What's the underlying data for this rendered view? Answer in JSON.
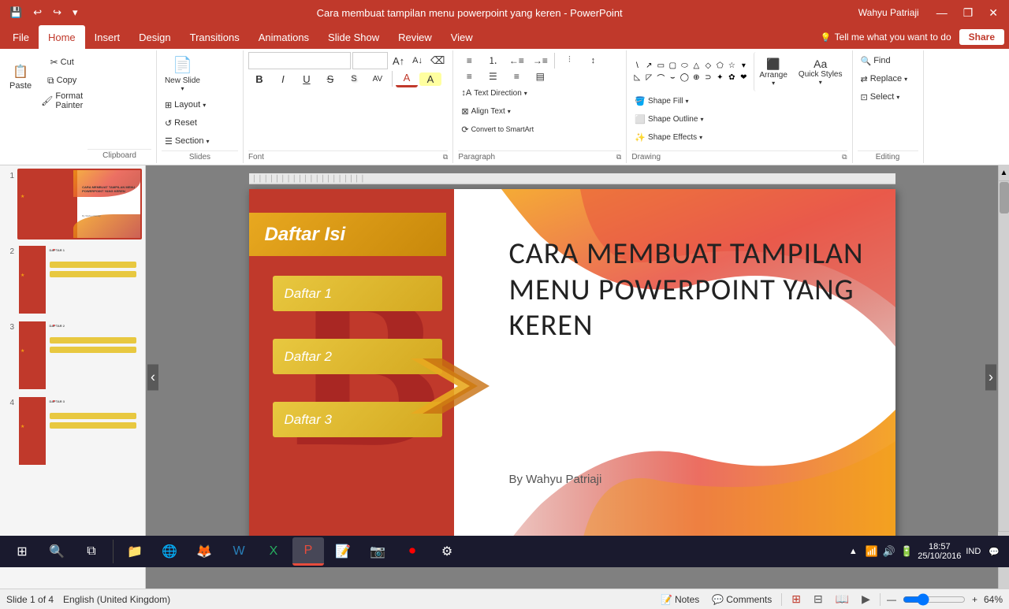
{
  "app": {
    "title": "Cara membuat tampilan menu powerpoint yang keren - PowerPoint",
    "user": "Wahyu Patriaji",
    "window_controls": [
      "minimize",
      "restore",
      "close"
    ]
  },
  "quick_access": {
    "buttons": [
      "save",
      "undo",
      "redo",
      "customize"
    ]
  },
  "tabs": [
    {
      "id": "file",
      "label": "File"
    },
    {
      "id": "home",
      "label": "Home",
      "active": true
    },
    {
      "id": "insert",
      "label": "Insert"
    },
    {
      "id": "design",
      "label": "Design"
    },
    {
      "id": "transitions",
      "label": "Transitions"
    },
    {
      "id": "animations",
      "label": "Animations"
    },
    {
      "id": "slideshow",
      "label": "Slide Show"
    },
    {
      "id": "review",
      "label": "Review"
    },
    {
      "id": "view",
      "label": "View"
    },
    {
      "id": "tellme",
      "label": "Tell me what you want to do"
    }
  ],
  "share_button": "Share",
  "ribbon": {
    "groups": {
      "clipboard": {
        "label": "Clipboard",
        "paste": "Paste",
        "cut": "Cut",
        "copy": "Copy",
        "format_painter": "Format Painter"
      },
      "slides": {
        "label": "Slides",
        "new_slide": "New Slide",
        "layout": "Layout",
        "reset": "Reset",
        "section": "Section"
      },
      "font": {
        "label": "Font",
        "font_name": "",
        "font_size": "",
        "grow": "A",
        "shrink": "A",
        "clear": "Clear All Formatting",
        "bold": "B",
        "italic": "I",
        "underline": "U",
        "strikethrough": "S",
        "shadow": "S",
        "char_spacing": "AV",
        "color": "A",
        "highlight": "A"
      },
      "paragraph": {
        "label": "Paragraph",
        "bullets": "Bullets",
        "numbering": "Numbering",
        "decrease_indent": "Decrease",
        "increase_indent": "Increase",
        "columns": "Columns",
        "line_spacing": "Line Spacing",
        "align_left": "Align Left",
        "align_center": "Center",
        "align_right": "Align Right",
        "justify": "Justify",
        "text_direction": "Text Direction",
        "align_text": "Align Text",
        "convert_smartart": "Convert to SmartArt"
      },
      "drawing": {
        "label": "Drawing",
        "arrange": "Arrange",
        "quick_styles": "Quick Styles",
        "shape_fill": "Shape Fill",
        "shape_outline": "Shape Outline",
        "shape_effects": "Shape Effects"
      },
      "editing": {
        "label": "Editing",
        "find": "Find",
        "replace": "Replace",
        "select": "Select"
      }
    }
  },
  "slide_panel": {
    "slides": [
      {
        "num": 1,
        "active": true,
        "type": "title"
      },
      {
        "num": 2,
        "active": false,
        "type": "content"
      },
      {
        "num": 3,
        "active": false,
        "type": "content"
      },
      {
        "num": 4,
        "active": false,
        "type": "content"
      }
    ]
  },
  "slide": {
    "title": "CARA MEMBUAT TAMPILAN MENU POWERPOINT YANG KEREN",
    "subtitle": "By Wahyu Patriaji",
    "toc_label": "Daftar Isi",
    "items": [
      {
        "label": "Daftar 1"
      },
      {
        "label": "Daftar 2"
      },
      {
        "label": "Daftar 3"
      }
    ]
  },
  "status_bar": {
    "slide_info": "Slide 1 of 4",
    "language": "English (United Kingdom)",
    "notes": "Notes",
    "comments": "Comments",
    "zoom": "64%"
  },
  "taskbar": {
    "start_label": "⊞",
    "apps": [
      "search",
      "taskview",
      "files",
      "edge",
      "firefox",
      "word",
      "excel",
      "powerpoint",
      "notepad",
      "camera"
    ],
    "time": "18:57",
    "date": "25/10/2016",
    "language": "IND"
  }
}
